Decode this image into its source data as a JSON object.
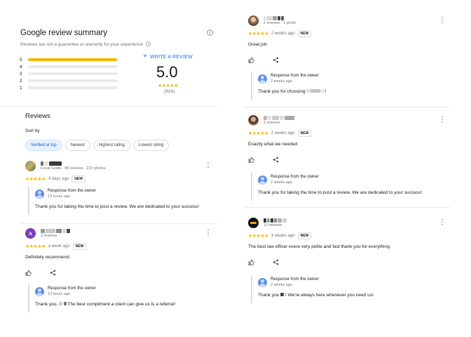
{
  "summary": {
    "title": "Google review summary",
    "subtitle": "Reviews are not a guarantee or warranty for your experience",
    "write_review": "WRITE A REVIEW",
    "average": "5.0",
    "count": "(924)",
    "distribution": [
      {
        "label": "5",
        "fraction": 0.99
      },
      {
        "label": "4",
        "fraction": 0.0
      },
      {
        "label": "3",
        "fraction": 0.0
      },
      {
        "label": "2",
        "fraction": 0.0
      },
      {
        "label": "1",
        "fraction": 0.0
      }
    ]
  },
  "reviews_section": {
    "heading": "Reviews",
    "sort_label": "Sort by",
    "chips": [
      "Verified at top",
      "Newest",
      "Highest rating",
      "Lowest rating"
    ]
  },
  "stars": "★★★★★",
  "new_badge": "NEW",
  "owner_title": "Response from the owner",
  "reviews_left": [
    {
      "meta": "Local Guide · 85 reviews · 222 photos",
      "time": "4 days ago",
      "owner_time": "13 hours ago",
      "owner_text": "Thank you for taking the time to post a review. We are dedicated to your success!"
    },
    {
      "avatar_letter": "a",
      "meta": "3 reviews",
      "time": "a week ago",
      "text": "Definitely recommend",
      "owner_time": "13 hours ago",
      "owner_text_a": "Thank you,",
      "owner_text_b": "The best compliment a client can give us is a referral!"
    }
  ],
  "reviews_right": [
    {
      "meta": "2 reviews · 1 photo",
      "time": "2 weeks ago",
      "text": "Great job",
      "owner_time": "2 weeks ago",
      "owner_text_a": "Thank you for choosing",
      "owner_text_b": "!"
    },
    {
      "meta": "2 reviews",
      "time": "2 weeks ago",
      "text": "Exactly what we needed",
      "owner_time": "2 weeks ago",
      "owner_text": "Thank you for taking the time to post a review. We are dedicated to your success!"
    },
    {
      "meta": "13 reviews",
      "time": "3 weeks ago",
      "text": "The best law officer evere very polite and fast thank you for everything.",
      "owner_time": "2 weeks ago",
      "owner_text_a": "Thank you",
      "owner_text_b": "! We're always here whenever you need us!"
    }
  ],
  "colors": {
    "star": "#f6b600",
    "accent": "#1a73e8",
    "chip_active_bg": "#e8f0fe",
    "avatar_letter_bg": "#7b3fb6"
  }
}
